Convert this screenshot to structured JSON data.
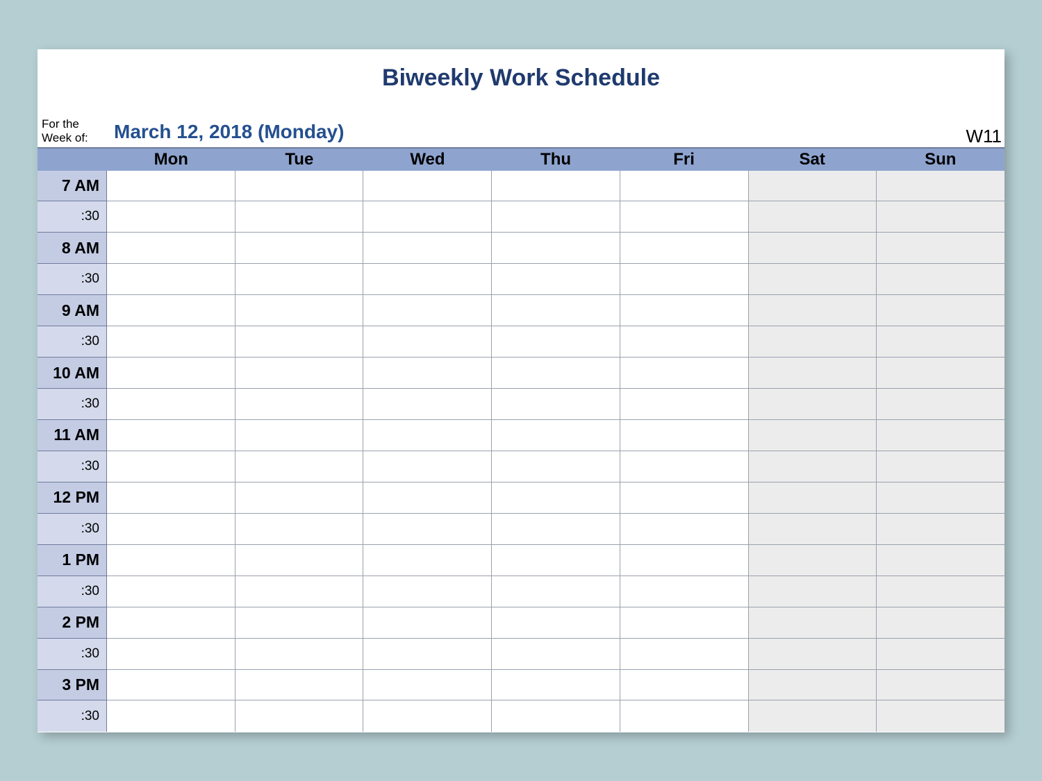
{
  "title": "Biweekly Work Schedule",
  "meta": {
    "label": "For the Week of:",
    "date": "March 12, 2018 (Monday)",
    "week": "W11"
  },
  "days": [
    "Mon",
    "Tue",
    "Wed",
    "Thu",
    "Fri",
    "Sat",
    "Sun"
  ],
  "times": [
    {
      "hour": "7 AM",
      "half": ":30"
    },
    {
      "hour": "8 AM",
      "half": ":30"
    },
    {
      "hour": "9 AM",
      "half": ":30"
    },
    {
      "hour": "10 AM",
      "half": ":30"
    },
    {
      "hour": "11 AM",
      "half": ":30"
    },
    {
      "hour": "12 PM",
      "half": ":30"
    },
    {
      "hour": "1 PM",
      "half": ":30"
    },
    {
      "hour": "2 PM",
      "half": ":30"
    },
    {
      "hour": "3 PM",
      "half": ":30"
    }
  ],
  "weekend_indices": [
    5,
    6
  ]
}
